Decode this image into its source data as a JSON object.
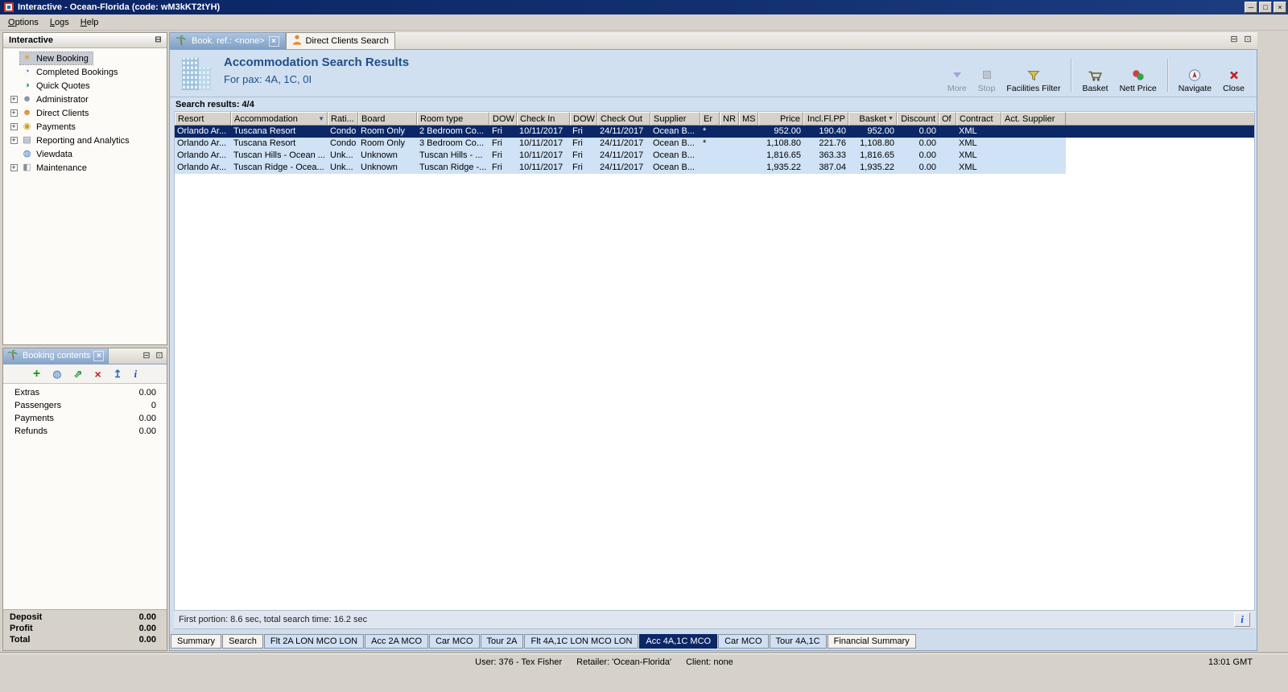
{
  "window": {
    "title": "Interactive - Ocean-Florida (code: wM3kKT2tYH)",
    "clock": "13:01 GMT",
    "status": {
      "user": "User: 376 - Tex Fisher",
      "retailer": "Retailer: 'Ocean-Florida'",
      "client": "Client: none"
    }
  },
  "menu": {
    "items": [
      "Options",
      "Logs",
      "Help"
    ]
  },
  "sidebar": {
    "title": "Interactive",
    "items": [
      {
        "label": "New Booking",
        "icon": "new-booking",
        "expandable": false,
        "selected": true
      },
      {
        "label": "Completed Bookings",
        "icon": "completed-bookings",
        "expandable": false,
        "selected": false
      },
      {
        "label": "Quick Quotes",
        "icon": "quick-quotes",
        "expandable": false,
        "selected": false
      },
      {
        "label": "Administrator",
        "icon": "administrator",
        "expandable": true,
        "selected": false
      },
      {
        "label": "Direct Clients",
        "icon": "direct-clients",
        "expandable": true,
        "selected": false
      },
      {
        "label": "Payments",
        "icon": "payments",
        "expandable": true,
        "selected": false
      },
      {
        "label": "Reporting and Analytics",
        "icon": "reporting",
        "expandable": true,
        "selected": false
      },
      {
        "label": "Viewdata",
        "icon": "viewdata",
        "expandable": false,
        "selected": false
      },
      {
        "label": "Maintenance",
        "icon": "maintenance",
        "expandable": true,
        "selected": false
      }
    ]
  },
  "booking_contents": {
    "title": "Booking contents",
    "toolbar": [
      {
        "icon": "add",
        "name": "add-item-button"
      },
      {
        "icon": "globe",
        "name": "quote-button"
      },
      {
        "icon": "export",
        "name": "export-button"
      },
      {
        "icon": "delete",
        "name": "delete-item-button"
      },
      {
        "icon": "move-up",
        "name": "move-up-button"
      },
      {
        "icon": "info",
        "name": "item-info-button"
      }
    ],
    "rows": [
      {
        "label": "Extras",
        "value": "0.00"
      },
      {
        "label": "Passengers",
        "value": "0"
      },
      {
        "label": "Payments",
        "value": "0.00"
      },
      {
        "label": "Refunds",
        "value": "0.00"
      }
    ],
    "totals": [
      {
        "label": "Deposit",
        "value": "0.00"
      },
      {
        "label": "Profit",
        "value": "0.00"
      },
      {
        "label": "Total",
        "value": "0.00"
      }
    ]
  },
  "main": {
    "tabs": [
      {
        "label": "Book. ref.: <none>",
        "icon": "palm",
        "active": true,
        "closable": true
      },
      {
        "label": "Direct Clients Search",
        "icon": "person",
        "active": false,
        "closable": false
      }
    ],
    "header": {
      "title": "Accommodation Search Results",
      "subtitle": "For pax: 4A, 1C, 0I"
    },
    "toolbar": [
      {
        "label": "More",
        "icon": "more",
        "disabled": true
      },
      {
        "label": "Stop",
        "icon": "stop",
        "disabled": true
      },
      {
        "label": "Facilities Filter",
        "icon": "filter",
        "disabled": false
      },
      {
        "sep": true
      },
      {
        "label": "Basket",
        "icon": "basket",
        "disabled": false
      },
      {
        "label": "Nett Price",
        "icon": "nett-price",
        "disabled": false
      },
      {
        "sep": true
      },
      {
        "label": "Navigate",
        "icon": "navigate",
        "disabled": false
      },
      {
        "label": "Close",
        "icon": "close",
        "disabled": false
      }
    ],
    "results_label": "Search results: 4/4",
    "status_text": "First portion: 8.6 sec, total search time: 16.2 sec"
  },
  "table": {
    "columns": [
      {
        "label": "Resort"
      },
      {
        "label": "Accommodation",
        "filter": true
      },
      {
        "label": "Rati..."
      },
      {
        "label": "Board"
      },
      {
        "label": "Room type"
      },
      {
        "label": "DOW"
      },
      {
        "label": "Check In"
      },
      {
        "label": "DOW"
      },
      {
        "label": "Check Out"
      },
      {
        "label": "Supplier"
      },
      {
        "label": "Er"
      },
      {
        "label": "NR"
      },
      {
        "label": "MS"
      },
      {
        "label": "Price",
        "align": "right"
      },
      {
        "label": "Incl.Fl.PP",
        "align": "right"
      },
      {
        "label": "Basket",
        "align": "right",
        "sort": "desc"
      },
      {
        "label": "Discount",
        "align": "right"
      },
      {
        "label": "Of"
      },
      {
        "label": "Contract"
      },
      {
        "label": "Act. Supplier"
      }
    ],
    "rows": [
      {
        "selected": true,
        "cells": [
          "Orlando Ar...",
          "Tuscana Resort",
          "Condo",
          "Room Only",
          "2 Bedroom Co...",
          "Fri",
          "10/11/2017",
          "Fri",
          "24/11/2017",
          "Ocean B...",
          "*",
          "",
          "",
          "952.00",
          "190.40",
          "952.00",
          "0.00",
          "",
          "XML",
          ""
        ]
      },
      {
        "selected": false,
        "cells": [
          "Orlando Ar...",
          "Tuscana Resort",
          "Condo",
          "Room Only",
          "3 Bedroom Co...",
          "Fri",
          "10/11/2017",
          "Fri",
          "24/11/2017",
          "Ocean B...",
          "*",
          "",
          "",
          "1,108.80",
          "221.76",
          "1,108.80",
          "0.00",
          "",
          "XML",
          ""
        ]
      },
      {
        "selected": false,
        "cells": [
          "Orlando Ar...",
          "Tuscan Hills - Ocean ...",
          "Unk...",
          "Unknown",
          "Tuscan Hills - ...",
          "Fri",
          "10/11/2017",
          "Fri",
          "24/11/2017",
          "Ocean B...",
          "",
          "",
          "",
          "1,816.65",
          "363.33",
          "1,816.65",
          "0.00",
          "",
          "XML",
          ""
        ]
      },
      {
        "selected": false,
        "cells": [
          "Orlando Ar...",
          "Tuscan Ridge - Ocea...",
          "Unk...",
          "Unknown",
          "Tuscan Ridge -...",
          "Fri",
          "10/11/2017",
          "Fri",
          "24/11/2017",
          "Ocean B...",
          "",
          "",
          "",
          "1,935.22",
          "387.04",
          "1,935.22",
          "0.00",
          "",
          "XML",
          ""
        ]
      }
    ]
  },
  "bottom_tabs": [
    {
      "label": "Summary",
      "style": "plain"
    },
    {
      "label": "Search",
      "style": "plain"
    },
    {
      "label": "Flt 2A LON MCO LON",
      "style": "blue"
    },
    {
      "label": "Acc 2A MCO",
      "style": "blue"
    },
    {
      "label": "Car MCO",
      "style": "blue"
    },
    {
      "label": "Tour 2A",
      "style": "blue"
    },
    {
      "label": "Flt 4A,1C LON MCO LON",
      "style": "blue"
    },
    {
      "label": "Acc 4A,1C MCO",
      "style": "active"
    },
    {
      "label": "Car MCO",
      "style": "blue"
    },
    {
      "label": "Tour 4A,1C",
      "style": "blue"
    },
    {
      "label": "Financial Summary",
      "style": "plain"
    }
  ],
  "colors": {
    "titlebar": "#0a2465",
    "selected_row": "#0c2766",
    "row_blue": "#cfe2f6",
    "content_blue": "#d0e0f0",
    "active_bottom_tab": "#0c2766"
  }
}
